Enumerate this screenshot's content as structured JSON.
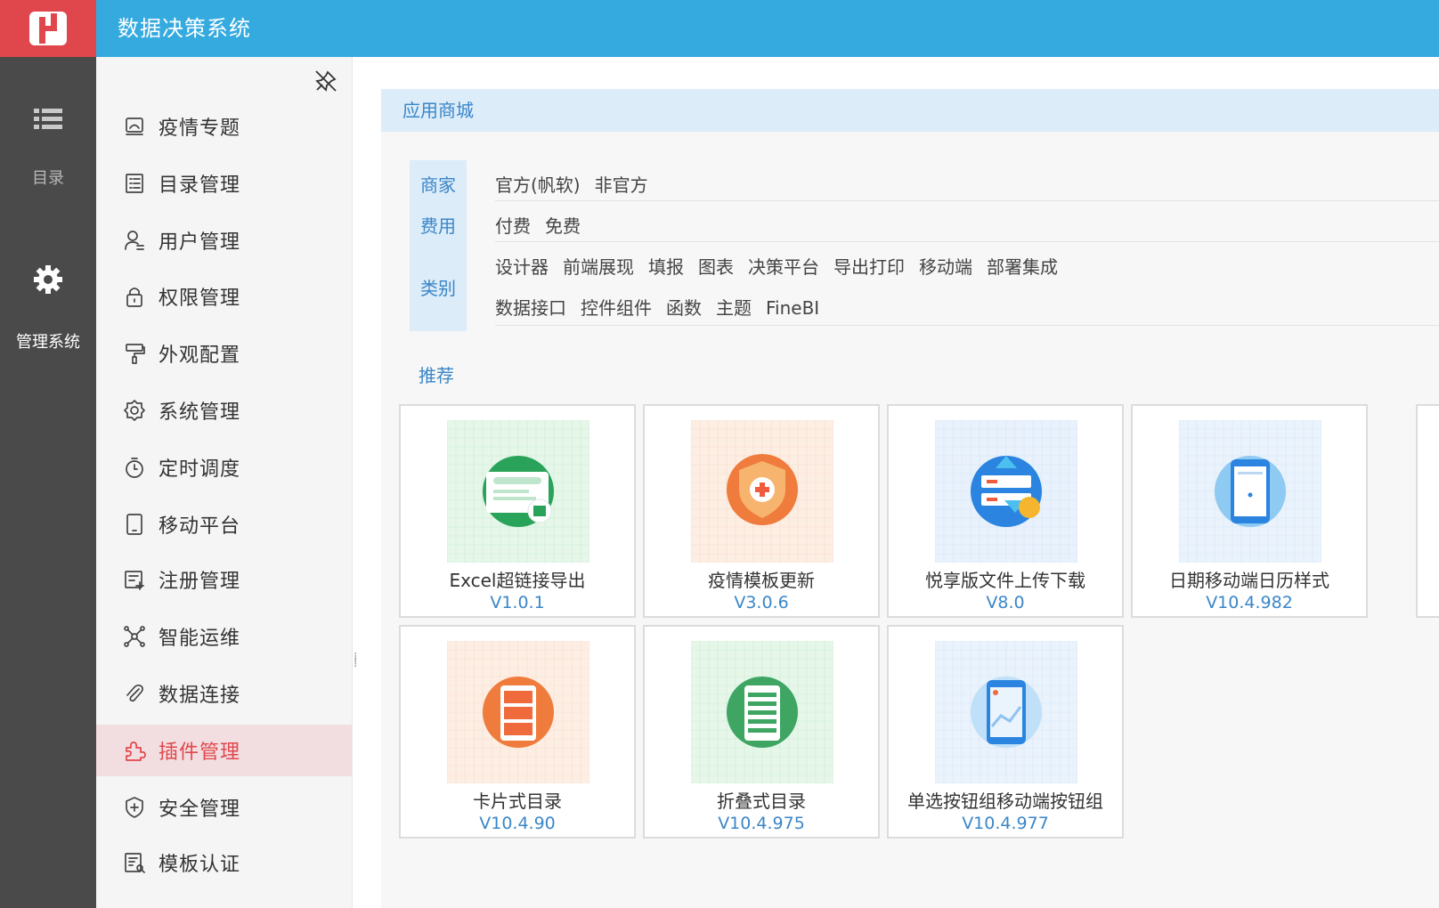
{
  "app": {
    "title": "数据决策系统"
  },
  "rail": {
    "catalog_label": "目录",
    "admin_label": "管理系统"
  },
  "sidebar": {
    "items": [
      {
        "label": "疫情专题",
        "icon": "monitor-icon"
      },
      {
        "label": "目录管理",
        "icon": "list-icon"
      },
      {
        "label": "用户管理",
        "icon": "user-icon"
      },
      {
        "label": "权限管理",
        "icon": "lock-icon"
      },
      {
        "label": "外观配置",
        "icon": "paint-roller-icon"
      },
      {
        "label": "系统管理",
        "icon": "gear-icon"
      },
      {
        "label": "定时调度",
        "icon": "stopwatch-icon"
      },
      {
        "label": "移动平台",
        "icon": "tablet-icon"
      },
      {
        "label": "注册管理",
        "icon": "register-icon"
      },
      {
        "label": "智能运维",
        "icon": "network-icon"
      },
      {
        "label": "数据连接",
        "icon": "paperclip-icon"
      },
      {
        "label": "插件管理",
        "icon": "puzzle-icon"
      },
      {
        "label": "安全管理",
        "icon": "shield-plus-icon"
      },
      {
        "label": "模板认证",
        "icon": "certificate-icon"
      }
    ],
    "active_index": 11,
    "active_color": "#e0474c"
  },
  "main": {
    "panel_title": "应用商城",
    "filters": {
      "vendor_label": "商家",
      "vendor_options": [
        "官方(帆软)",
        "非官方"
      ],
      "fee_label": "费用",
      "fee_options": [
        "付费",
        "免费"
      ],
      "category_label": "类别",
      "category_options_row1": [
        "设计器",
        "前端展现",
        "填报",
        "图表",
        "决策平台",
        "导出打印",
        "移动端",
        "部署集成"
      ],
      "category_options_row2": [
        "数据接口",
        "控件组件",
        "函数",
        "主题",
        "FineBI"
      ]
    },
    "recommend_label": "推荐",
    "plugins": [
      {
        "name": "Excel超链接导出",
        "version": "V1.0.1",
        "icon": "excel-link-icon"
      },
      {
        "name": "疫情模板更新",
        "version": "V3.0.6",
        "icon": "medical-shield-icon"
      },
      {
        "name": "悦享版文件上传下载",
        "version": "V8.0",
        "icon": "upload-download-icon"
      },
      {
        "name": "日期移动端日历样式",
        "version": "V10.4.982",
        "icon": "mobile-calendar-icon"
      },
      {
        "name": "卡片式目录",
        "version": "V10.4.90",
        "icon": "card-catalog-icon"
      },
      {
        "name": "折叠式目录",
        "version": "V10.4.975",
        "icon": "fold-catalog-icon"
      },
      {
        "name": "单选按钮组移动端按钮组",
        "version": "V10.4.977",
        "icon": "mobile-button-group-icon"
      }
    ]
  },
  "colors": {
    "topbar": "#35aadf",
    "logo_bg": "#e0474c",
    "rail_bg": "#4a4a4a",
    "accent_blue": "#3a86c8"
  }
}
